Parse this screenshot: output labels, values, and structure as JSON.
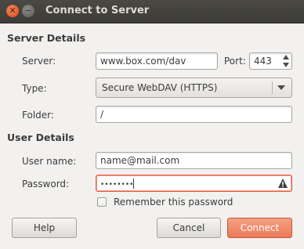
{
  "window": {
    "title": "Connect to Server"
  },
  "sections": {
    "server_details": "Server Details",
    "user_details": "User Details"
  },
  "server": {
    "server_label": "Server:",
    "server_value": "www.box.com/dav",
    "port_label": "Port:",
    "port_value": "443",
    "type_label": "Type:",
    "type_value": "Secure WebDAV (HTTPS)",
    "folder_label": "Folder:",
    "folder_value": "/"
  },
  "user": {
    "username_label": "User name:",
    "username_value": "name@mail.com",
    "password_label": "Password:",
    "password_value": "••••••••",
    "remember_label": "Remember this password",
    "remember_checked": false
  },
  "buttons": {
    "help": "Help",
    "cancel": "Cancel",
    "connect": "Connect"
  },
  "colors": {
    "accent": "#ec7a57",
    "error_border": "#e25c42",
    "titlebar": "#3c3b37"
  },
  "icons": {
    "warning": "warning-icon"
  }
}
